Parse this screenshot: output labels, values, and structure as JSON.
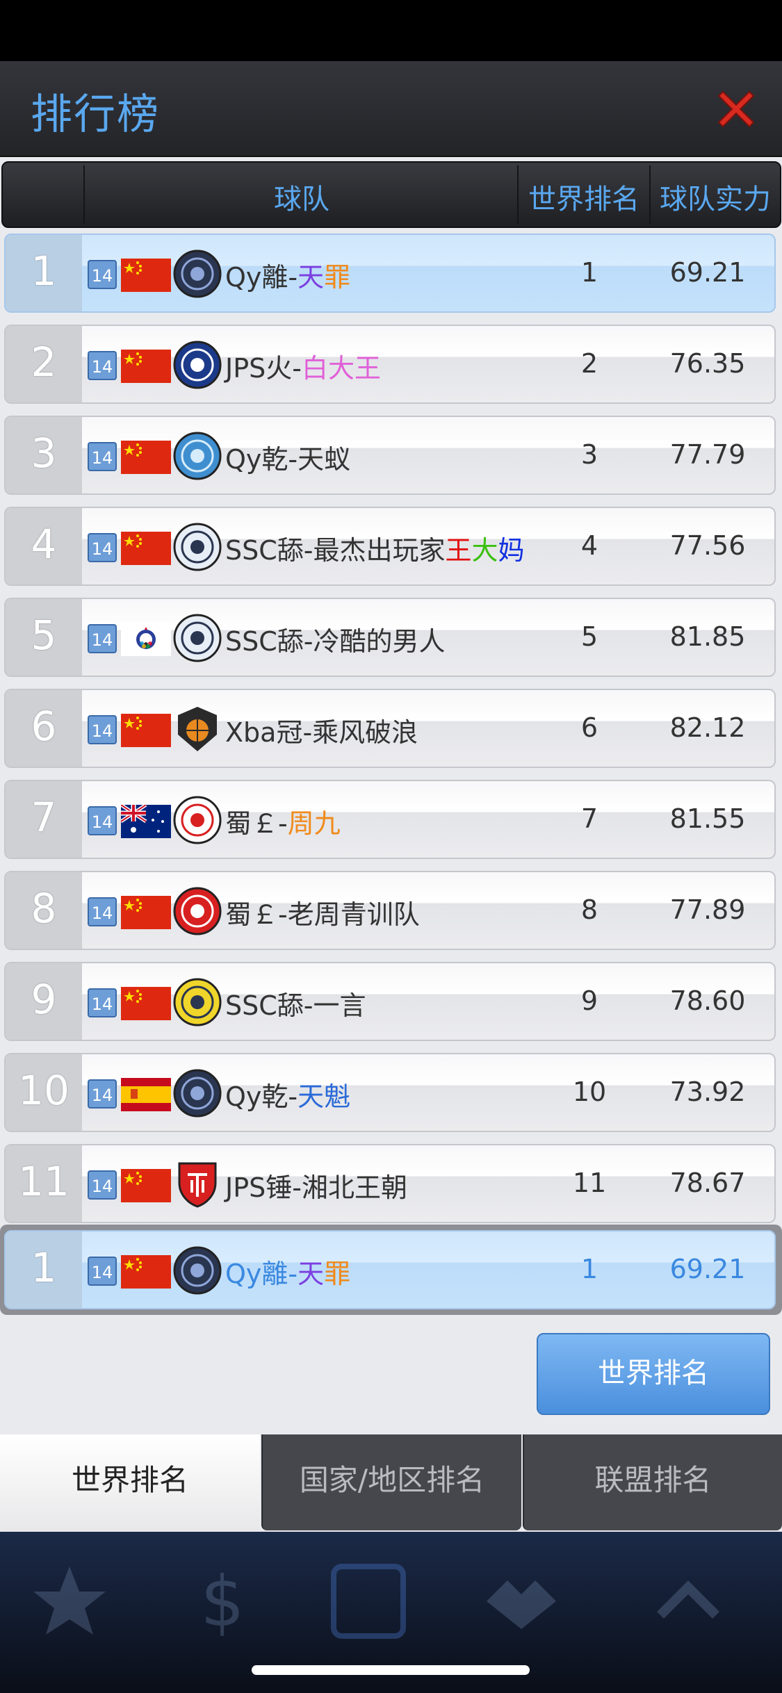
{
  "title": "排行榜",
  "headers": {
    "team": "球队",
    "world_rank": "世界排名",
    "strength": "球队实力"
  },
  "rows": [
    {
      "rank": "1",
      "level": "14",
      "flag": "china-flag",
      "logo": "qy-logo",
      "name_pre": "Qy離-",
      "name_parts": [
        {
          "t": "天",
          "c": "#7b3fe0"
        },
        {
          "t": "罪",
          "c": "#f08a1c"
        }
      ],
      "world_rank": "1",
      "strength": "69.21",
      "highlight": true
    },
    {
      "rank": "2",
      "level": "14",
      "flag": "china-flag",
      "logo": "unicorn-logo",
      "name_pre": "JPS火-",
      "name_parts": [
        {
          "t": "白大王",
          "c": "#e060d8"
        }
      ],
      "world_rank": "2",
      "strength": "76.35"
    },
    {
      "rank": "3",
      "level": "14",
      "flag": "china-flag",
      "logo": "qy-blue-logo",
      "name_pre": "Qy乾-天蚁",
      "name_parts": [],
      "world_rank": "3",
      "strength": "77.79"
    },
    {
      "rank": "4",
      "level": "14",
      "flag": "china-flag",
      "logo": "ssc-logo",
      "name_pre": "SSC舔-最杰出玩家",
      "name_parts": [
        {
          "t": "王",
          "c": "#e01010"
        },
        {
          "t": "大",
          "c": "#3ac010"
        },
        {
          "t": "妈",
          "c": "#1030e0"
        }
      ],
      "world_rank": "4",
      "strength": "77.56"
    },
    {
      "rank": "5",
      "level": "14",
      "flag": "chinese-taipei-flag",
      "logo": "ssc-logo",
      "name_pre": "SSC舔-冷酷的男人",
      "name_parts": [],
      "world_rank": "5",
      "strength": "81.85"
    },
    {
      "rank": "6",
      "level": "14",
      "flag": "china-flag",
      "logo": "xba-logo",
      "name_pre": "Xba冠-乘风破浪",
      "name_parts": [],
      "world_rank": "6",
      "strength": "82.12"
    },
    {
      "rank": "7",
      "level": "14",
      "flag": "australia-flag",
      "logo": "panda-logo",
      "name_pre": "蜀￡-",
      "name_parts": [
        {
          "t": "周九",
          "c": "#f08a1c"
        }
      ],
      "world_rank": "7",
      "strength": "81.55"
    },
    {
      "rank": "8",
      "level": "14",
      "flag": "china-flag",
      "logo": "panda-red-logo",
      "name_pre": "蜀￡-老周青训队",
      "name_parts": [],
      "world_rank": "8",
      "strength": "77.89"
    },
    {
      "rank": "9",
      "level": "14",
      "flag": "china-flag",
      "logo": "ssc-yellow-logo",
      "name_pre": "SSC舔-一言",
      "name_parts": [],
      "world_rank": "9",
      "strength": "78.60"
    },
    {
      "rank": "10",
      "level": "14",
      "flag": "spain-flag",
      "logo": "qy-logo",
      "name_pre": "Qy乾-",
      "name_parts": [
        {
          "t": "天魁",
          "c": "#2a6ad8"
        }
      ],
      "world_rank": "10",
      "strength": "73.92"
    },
    {
      "rank": "11",
      "level": "14",
      "flag": "china-flag",
      "logo": "shield-logo",
      "name_pre": "JPS锤-湘北王朝",
      "name_parts": [],
      "world_rank": "11",
      "strength": "78.67"
    }
  ],
  "my_row": {
    "rank": "1",
    "level": "14",
    "flag": "china-flag",
    "logo": "qy-logo",
    "name_pre": "Qy離-",
    "name_parts": [
      {
        "t": "天",
        "c": "#7b3fe0"
      },
      {
        "t": "罪",
        "c": "#f08a1c"
      }
    ],
    "world_rank": "1",
    "strength": "69.21"
  },
  "world_rank_button": "世界排名",
  "tabs": [
    {
      "label": "世界排名",
      "active": true
    },
    {
      "label": "国家/地区排名",
      "active": false
    },
    {
      "label": "联盟排名",
      "active": false
    }
  ],
  "colors": {
    "accent": "#5aa8f0",
    "highlight_row": "#c5e2fb",
    "close": "#d82a20"
  }
}
